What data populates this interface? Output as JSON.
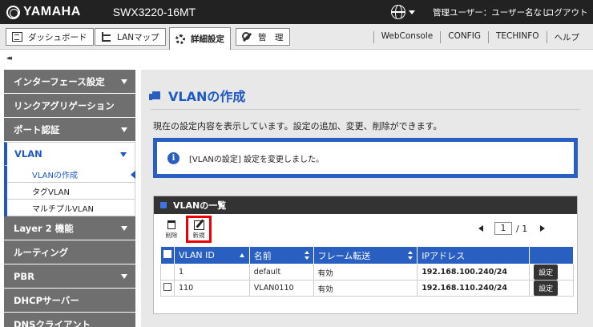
{
  "header": {
    "brand": "YAMAHA",
    "model": "SWX3220-16MT",
    "user_info": "管理ユーザー：ユーザー名なし",
    "logout": "ログアウト"
  },
  "toolbar": {
    "dashboard": "ダッシュボード",
    "lanmap": "LANマップ",
    "detail": "詳細設定",
    "manage": "管　理",
    "links": [
      "WebConsole",
      "CONFIG",
      "TECHINFO",
      "ヘルプ"
    ]
  },
  "collapse_label": "◂◂",
  "sidebar": {
    "items": [
      {
        "label": "インターフェース設定",
        "caret": true
      },
      {
        "label": "リンクアグリゲーション",
        "caret": false
      },
      {
        "label": "ポート認証",
        "caret": true
      },
      {
        "label": "VLAN",
        "caret": true
      },
      {
        "label": "Layer 2 機能",
        "caret": true
      },
      {
        "label": "ルーティング",
        "caret": false
      },
      {
        "label": "PBR",
        "caret": true
      },
      {
        "label": "DHCPサーバー",
        "caret": false
      },
      {
        "label": "DNSクライアント",
        "caret": false
      }
    ],
    "vlan_sub": [
      "VLANの作成",
      "タグVLAN",
      "マルチプルVLAN"
    ]
  },
  "main": {
    "title": "VLANの作成",
    "description": "現在の設定内容を表示しています。設定の追加、変更、削除ができます。",
    "notice": "[VLANの設定] 設定を変更しました。",
    "panel_title": "VLANの一覧",
    "delete_label": "削除",
    "new_label": "新規",
    "pager": {
      "current": "1",
      "total": "/ 1"
    },
    "table": {
      "headers": [
        "VLAN ID",
        "名前",
        "フレーム転送",
        "IPアドレス"
      ],
      "rows": [
        {
          "vlan_id": "1",
          "name": "default",
          "forward": "有効",
          "ip": "192.168.100.240/24",
          "button": "設定"
        },
        {
          "vlan_id": "110",
          "name": "VLAN0110",
          "forward": "有効",
          "ip": "192.168.110.240/24",
          "button": "設定"
        }
      ]
    }
  },
  "colors": {
    "accent": "#1d58c4",
    "header_bg": "#222222",
    "highlight": "#ee0000"
  }
}
